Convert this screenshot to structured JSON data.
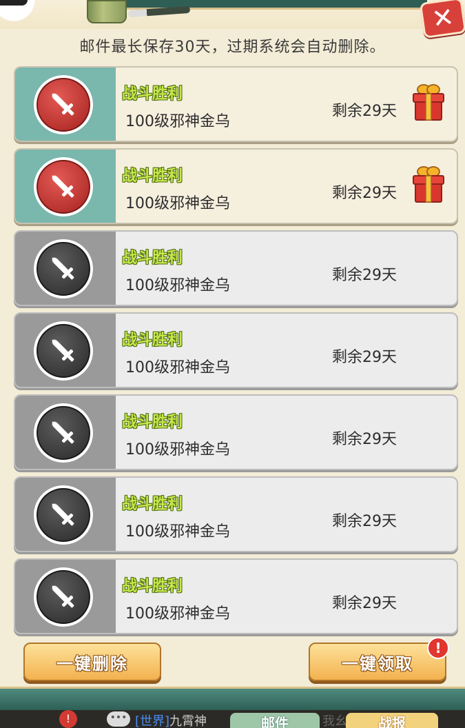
{
  "notice": "邮件最长保存30天，过期系统会自动删除。",
  "close_icon": "close-x-icon",
  "mails": [
    {
      "title": "战斗胜利",
      "subject": "100级邪神金乌",
      "remaining": "剩余29天",
      "read": false,
      "has_gift": true
    },
    {
      "title": "战斗胜利",
      "subject": "100级邪神金乌",
      "remaining": "剩余29天",
      "read": false,
      "has_gift": true
    },
    {
      "title": "战斗胜利",
      "subject": "100级邪神金乌",
      "remaining": "剩余29天",
      "read": true,
      "has_gift": false
    },
    {
      "title": "战斗胜利",
      "subject": "100级邪神金乌",
      "remaining": "剩余29天",
      "read": true,
      "has_gift": false
    },
    {
      "title": "战斗胜利",
      "subject": "100级邪神金乌",
      "remaining": "剩余29天",
      "read": true,
      "has_gift": false
    },
    {
      "title": "战斗胜利",
      "subject": "100级邪神金乌",
      "remaining": "剩余29天",
      "read": true,
      "has_gift": false
    },
    {
      "title": "战斗胜利",
      "subject": "100级邪神金乌",
      "remaining": "剩余29天",
      "read": true,
      "has_gift": false
    }
  ],
  "buttons": {
    "delete_all": "一键删除",
    "claim_all": "一键领取",
    "claim_alert": "!"
  },
  "bottom": {
    "chat_channel": "[世界]",
    "chat_name": "九霄神",
    "chat_partial": "我幺",
    "tab_mail": "邮件",
    "tab_report": "战报",
    "warn": "!"
  },
  "colors": {
    "unread_panel": "#7ab7ad",
    "read_panel": "#9a9a9a",
    "title_green": "#c6e84a",
    "button_gold": "#f3b14f"
  }
}
